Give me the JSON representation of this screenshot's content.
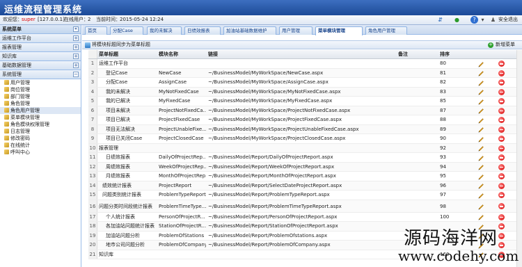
{
  "app": {
    "title": "运维流程管理系统"
  },
  "infobar": {
    "welcome_label": "欢迎您：",
    "user": "super",
    "ip": "[127.0.0.1]",
    "online_label": "在线用户：",
    "online_count": "2",
    "time_label": "当前时间：",
    "time": "2015-05-24 12:24",
    "logout": "安全退出"
  },
  "sidebar": {
    "header": "系统菜单",
    "groups": [
      {
        "label": "运维工作平台",
        "toggle": "+"
      },
      {
        "label": "报表管理",
        "toggle": "+"
      },
      {
        "label": "知识库",
        "toggle": "+"
      },
      {
        "label": "基础数据管理",
        "toggle": "+"
      },
      {
        "label": "系统管理",
        "toggle": "−"
      }
    ],
    "items": [
      "用户管理",
      "岗位管理",
      "部门管理",
      "角色管理",
      "角色用户管理",
      "菜单模块管理",
      "角色模块权限管理",
      "日志管理",
      "修改密码",
      "在线统计",
      "呼叫中心"
    ],
    "selected_index": 4
  },
  "tabs": [
    "首页",
    "分配Case",
    "我的未解决",
    "日绩效报表",
    "加油站基础数据维护",
    "用户管理",
    "菜单模块管理",
    "角色用户管理"
  ],
  "active_tab": 6,
  "toolbar": {
    "sync_label": "将模块标题同步为菜单标题",
    "add_label": "新增菜单"
  },
  "grid": {
    "columns": [
      "菜单标题",
      "模块名称",
      "链接",
      "备注",
      "排序"
    ],
    "rows": [
      {
        "num": "1",
        "title": "运维工作平台",
        "module": "",
        "link": "",
        "remark": "",
        "sort": "80",
        "indent": 0
      },
      {
        "num": "2",
        "title": "登记Case",
        "module": "NewCase",
        "link": "~/BusinessModel/MyWorkSpace/NewCase.aspx",
        "remark": "",
        "sort": "81",
        "indent": 2
      },
      {
        "num": "3",
        "title": "分配Case",
        "module": "AssignCase",
        "link": "~/BusinessModel/MyWorkSpace/AssignCase.aspx",
        "remark": "",
        "sort": "82",
        "indent": 2
      },
      {
        "num": "4",
        "title": "我的未解决",
        "module": "MyNotFixedCase",
        "link": "~/BusinessModel/MyWorkSpace/MyNotFixedCase.aspx",
        "remark": "",
        "sort": "83",
        "indent": 2
      },
      {
        "num": "5",
        "title": "我的已解决",
        "module": "MyFixedCase",
        "link": "~/BusinessModel/MyWorkSpace/MyFixedCase.aspx",
        "remark": "",
        "sort": "85",
        "indent": 2
      },
      {
        "num": "6",
        "title": "项目未解决",
        "module": "ProjectNotFixedCa...",
        "link": "~/BusinessModel/MyWorkSpace/ProjectNotFixedCase.aspx",
        "remark": "",
        "sort": "87",
        "indent": 2
      },
      {
        "num": "7",
        "title": "项目已解决",
        "module": "ProjectFixedCase",
        "link": "~/BusinessModel/MyWorkSpace/ProjectFixedCase.aspx",
        "remark": "",
        "sort": "88",
        "indent": 2
      },
      {
        "num": "8",
        "title": "项目无法解决",
        "module": "ProjectUnableFixe...",
        "link": "~/BusinessModel/MyWorkSpace/ProjectUnableFixedCase.aspx",
        "remark": "",
        "sort": "89",
        "indent": 2
      },
      {
        "num": "9",
        "title": "项目已关闭Case",
        "module": "ProjectClosedCase",
        "link": "~/BusinessModel/MyWorkSpace/ProjectClosedCase.aspx",
        "remark": "",
        "sort": "90",
        "indent": 2
      },
      {
        "num": "10",
        "title": "报表管理",
        "module": "",
        "link": "",
        "remark": "",
        "sort": "92",
        "indent": 0
      },
      {
        "num": "11",
        "title": "日绩效报表",
        "module": "DailyOfProjectRep...",
        "link": "~/BusinessModel/Report/DailyOfProjectReport.aspx",
        "remark": "",
        "sort": "93",
        "indent": 2
      },
      {
        "num": "12",
        "title": "周绩效报表",
        "module": "WeekOfProjectRep...",
        "link": "~/BusinessModel/Report/WeekOfProjectReport.aspx",
        "remark": "",
        "sort": "94",
        "indent": 2
      },
      {
        "num": "13",
        "title": "月绩效报表",
        "module": "MonthOfProjectRep...",
        "link": "~/BusinessModel/Report/MonthOfProjectReport.aspx",
        "remark": "",
        "sort": "95",
        "indent": 2
      },
      {
        "num": "14",
        "title": "绩效统计报表",
        "module": "ProjectReport",
        "link": "~/BusinessModel/Report/SelectDateProjectReport.aspx",
        "remark": "",
        "sort": "96",
        "indent": 1
      },
      {
        "num": "15",
        "title": "问题类别统计报表",
        "module": "ProblemTypeReport",
        "link": "~/BusinessModel/Report/ProblemTypeReport.aspx",
        "remark": "",
        "sort": "97",
        "indent": 1
      },
      {
        "num": "16",
        "title": "问题分类时间段统计报表",
        "module": "ProblemTimeType...",
        "link": "~/BusinessModel/Report/ProblemTimeTypeReport.aspx",
        "remark": "",
        "sort": "98",
        "indent": 0,
        "tall": true
      },
      {
        "num": "17",
        "title": "个人统计报表",
        "module": "PersonOfProjectR...",
        "link": "~/BusinessModel/Report/PersonOfProjectReport.aspx",
        "remark": "",
        "sort": "100",
        "indent": 2
      },
      {
        "num": "18",
        "title": "各加油站问题统计报表",
        "module": "StationOfProjectR...",
        "link": "~/BusinessModel/Report/StationOfProjectReport.aspx",
        "remark": "",
        "sort": "",
        "indent": 2
      },
      {
        "num": "19",
        "title": "加油站问题分析",
        "module": "ProblemOfStations",
        "link": "~/BusinessModel/Report/ProblemOfstations.aspx",
        "remark": "",
        "sort": "",
        "indent": 2
      },
      {
        "num": "20",
        "title": "地市公司问题分析",
        "module": "ProblemOfCompany",
        "link": "~/BusinessModel/Report/ProblemOfCompany.aspx",
        "remark": "",
        "sort": "",
        "indent": 2
      },
      {
        "num": "21",
        "title": "知识库",
        "module": "",
        "link": "",
        "remark": "",
        "sort": "160",
        "indent": 0
      }
    ]
  },
  "watermark": {
    "line1": "源码海洋网",
    "line2": "www.codehy.com"
  }
}
